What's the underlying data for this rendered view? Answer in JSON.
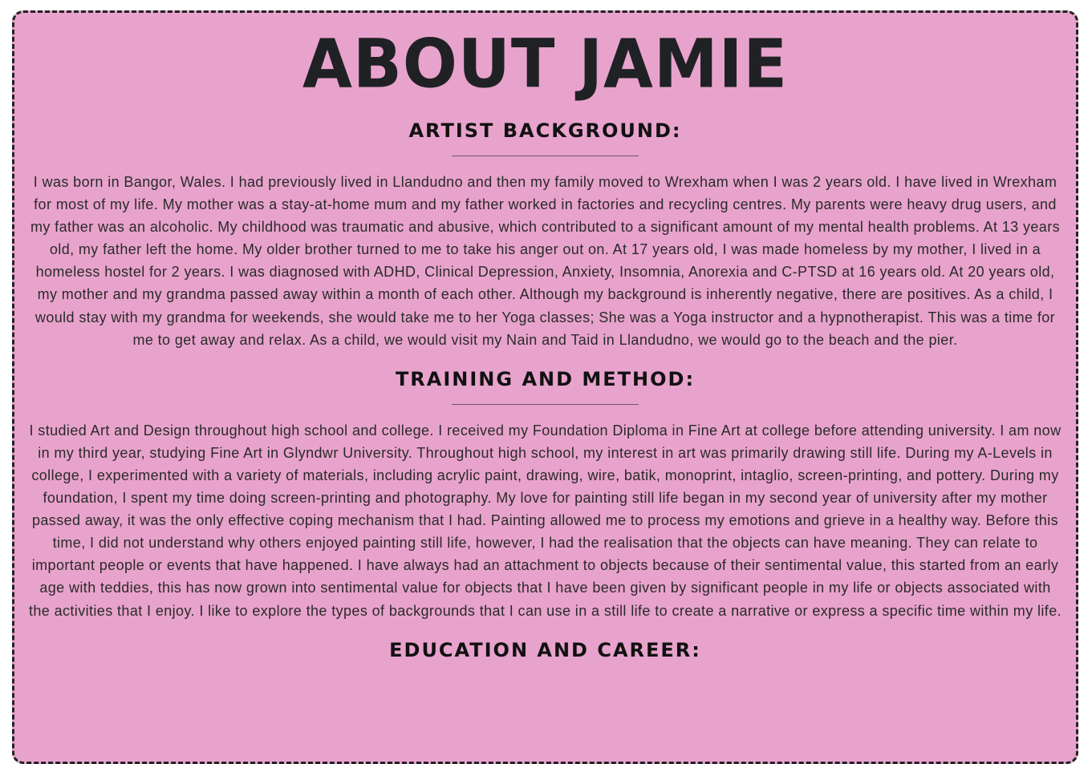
{
  "page": {
    "title": "ABOUT JAMIE"
  },
  "sections": [
    {
      "heading": "ARTIST BACKGROUND:",
      "body": "I was born in Bangor, Wales. I had previously lived in Llandudno and then my family moved to Wrexham when I was 2 years old. I have lived in Wrexham for most of my life. My mother was a stay-at-home mum and my father worked in factories and recycling centres. My parents were heavy drug users, and my father was an alcoholic. My childhood was traumatic and abusive, which contributed to a significant amount of my mental health problems. At 13 years old, my father left the home. My older brother turned to me to take his anger out on. At 17 years old, I was made homeless by my mother, I lived in a homeless hostel for 2 years. I was diagnosed with ADHD, Clinical Depression, Anxiety, Insomnia, Anorexia and C-PTSD at 16 years old. At 20 years old, my mother and my grandma passed away within a month of each other. Although my background is inherently negative, there are positives. As a child, I would stay with my grandma for weekends, she would take me to her Yoga classes; She was a Yoga instructor and a hypnotherapist. This was a time for me to get away and relax. As a child, we would visit my Nain and Taid in Llandudno, we would go to the beach and the pier."
    },
    {
      "heading": "TRAINING AND METHOD:",
      "body": "I studied Art and Design throughout high school and college. I received my Foundation Diploma in Fine Art at college before attending university. I am now in my third year, studying Fine Art in Glyndwr University. Throughout high school, my interest in art was primarily drawing still life. During my A-Levels in college, I experimented with a variety of materials, including acrylic paint, drawing, wire, batik, monoprint, intaglio, screen-printing, and pottery. During my foundation, I spent my time doing screen-printing and photography. My love for painting still life began in my second year of university after my mother passed away, it was the only effective coping mechanism that I had. Painting allowed me to process my emotions and grieve in a healthy way. Before this time, I did not understand why others enjoyed painting still life, however, I had the realisation that the objects can have meaning. They can relate to important people or events that have happened. I have always had an attachment to objects because of their sentimental value, this started from an early age with teddies, this has now grown into sentimental value for objects that I have been given by significant people in my life or objects associated with the activities that I enjoy. I like to explore the types of backgrounds that I can use in a still life to create a narrative or express a specific time within my life."
    },
    {
      "heading": "EDUCATION AND CAREER:"
    }
  ],
  "colors": {
    "panel_background": "#e8a3cc",
    "heading_text": "#202124",
    "body_text": "#2a2a2a",
    "border": "#222222"
  }
}
